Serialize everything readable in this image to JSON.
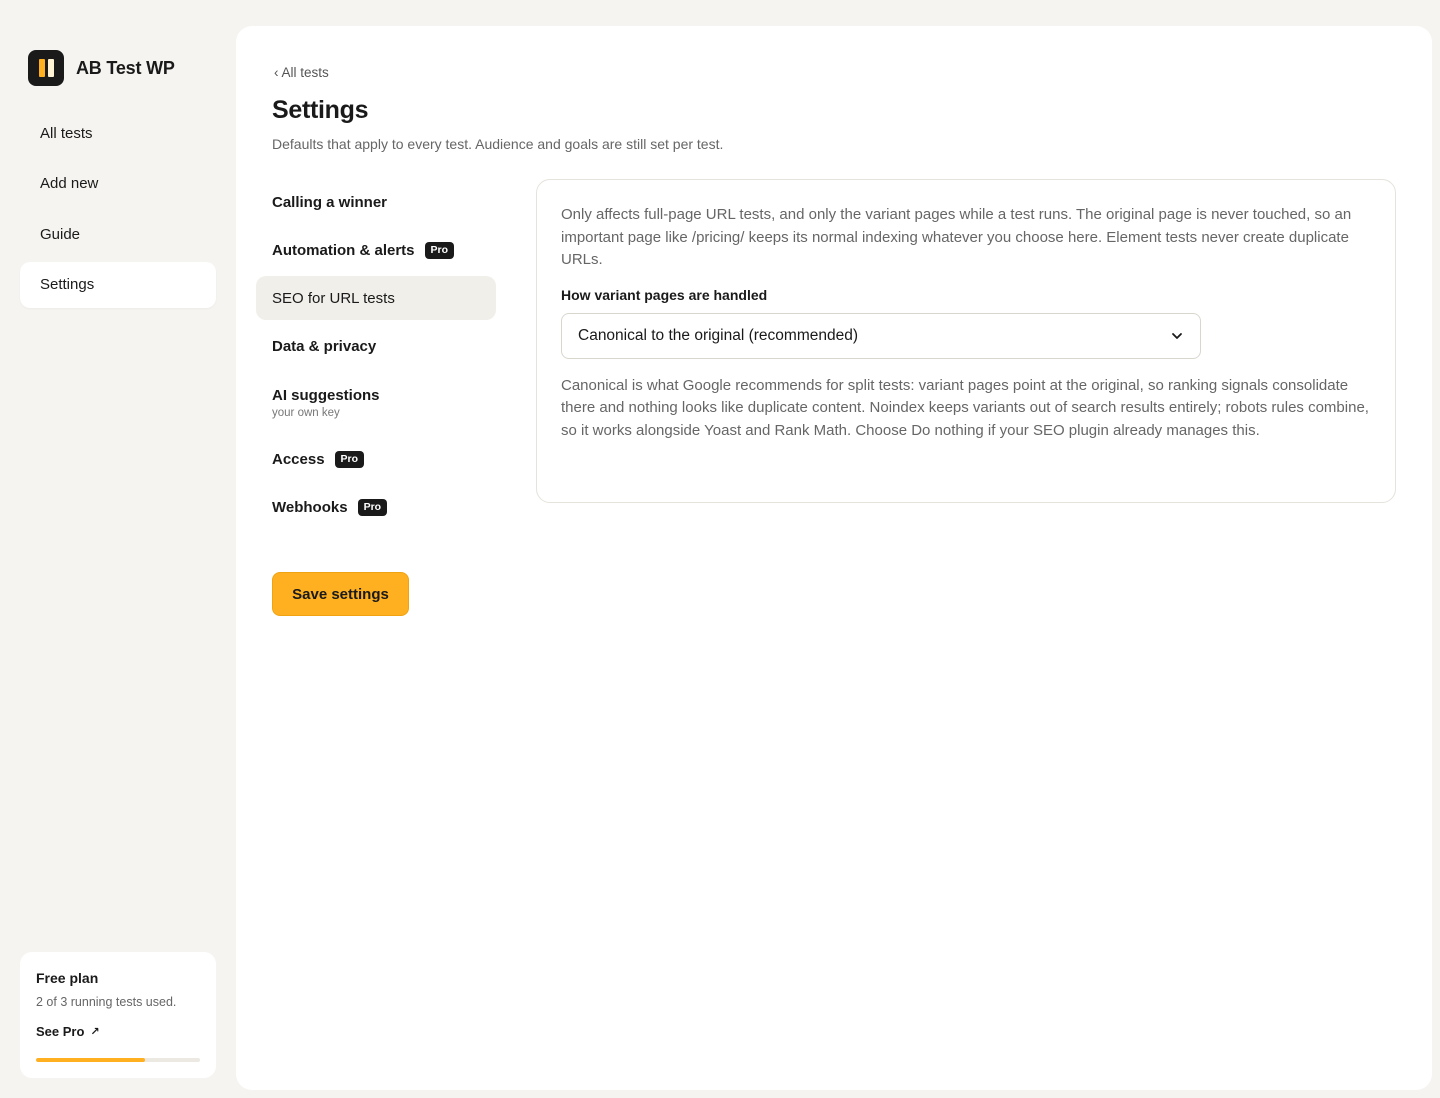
{
  "brand": {
    "name": "AB Test WP",
    "icon": "logo-icon",
    "accent_color": "#ffb020"
  },
  "sidebar": {
    "items": [
      {
        "label": "All tests",
        "active": false
      },
      {
        "label": "Add new",
        "active": false
      },
      {
        "label": "Guide",
        "active": false
      },
      {
        "label": "Settings",
        "active": true
      }
    ]
  },
  "plan": {
    "title": "Free plan",
    "usage_text": "2 of 3 running tests used.",
    "link_label": "See Pro",
    "link_icon": "arrow-up-right-icon",
    "progress_fraction": 0.667
  },
  "main": {
    "back_label": "All tests",
    "title": "Settings",
    "subtitle": "Defaults that apply to every test. Audience and goals are still set per test."
  },
  "settings_nav": [
    {
      "label": "Calling a winner",
      "sub": "",
      "pro": false,
      "active": false
    },
    {
      "label": "Automation & alerts",
      "sub": "",
      "pro": true,
      "active": false
    },
    {
      "label": "SEO for URL tests",
      "sub": "",
      "pro": false,
      "active": true
    },
    {
      "label": "Data & privacy",
      "sub": "",
      "pro": false,
      "active": false
    },
    {
      "label": "AI suggestions",
      "sub": "your own key",
      "pro": false,
      "active": false
    },
    {
      "label": "Access",
      "sub": "",
      "pro": true,
      "active": false
    },
    {
      "label": "Webhooks",
      "sub": "",
      "pro": true,
      "active": false
    }
  ],
  "pro_badge_label": "Pro",
  "save_label": "Save settings",
  "seo": {
    "intro": "Only affects full-page URL tests, and only the variant pages while a test runs. The original page is never touched, so an important page like /pricing/ keeps its normal indexing whatever you choose here. Element tests never create duplicate URLs.",
    "field_label": "How variant pages are handled",
    "select_value": "Canonical to the original (recommended)",
    "help": "Canonical is what Google recommends for split tests: variant pages point at the original, so ranking signals consolidate there and nothing looks like duplicate content. Noindex keeps variants out of search results entirely; robots rules combine, so it works alongside Yoast and Rank Math. Choose Do nothing if your SEO plugin already manages this."
  }
}
